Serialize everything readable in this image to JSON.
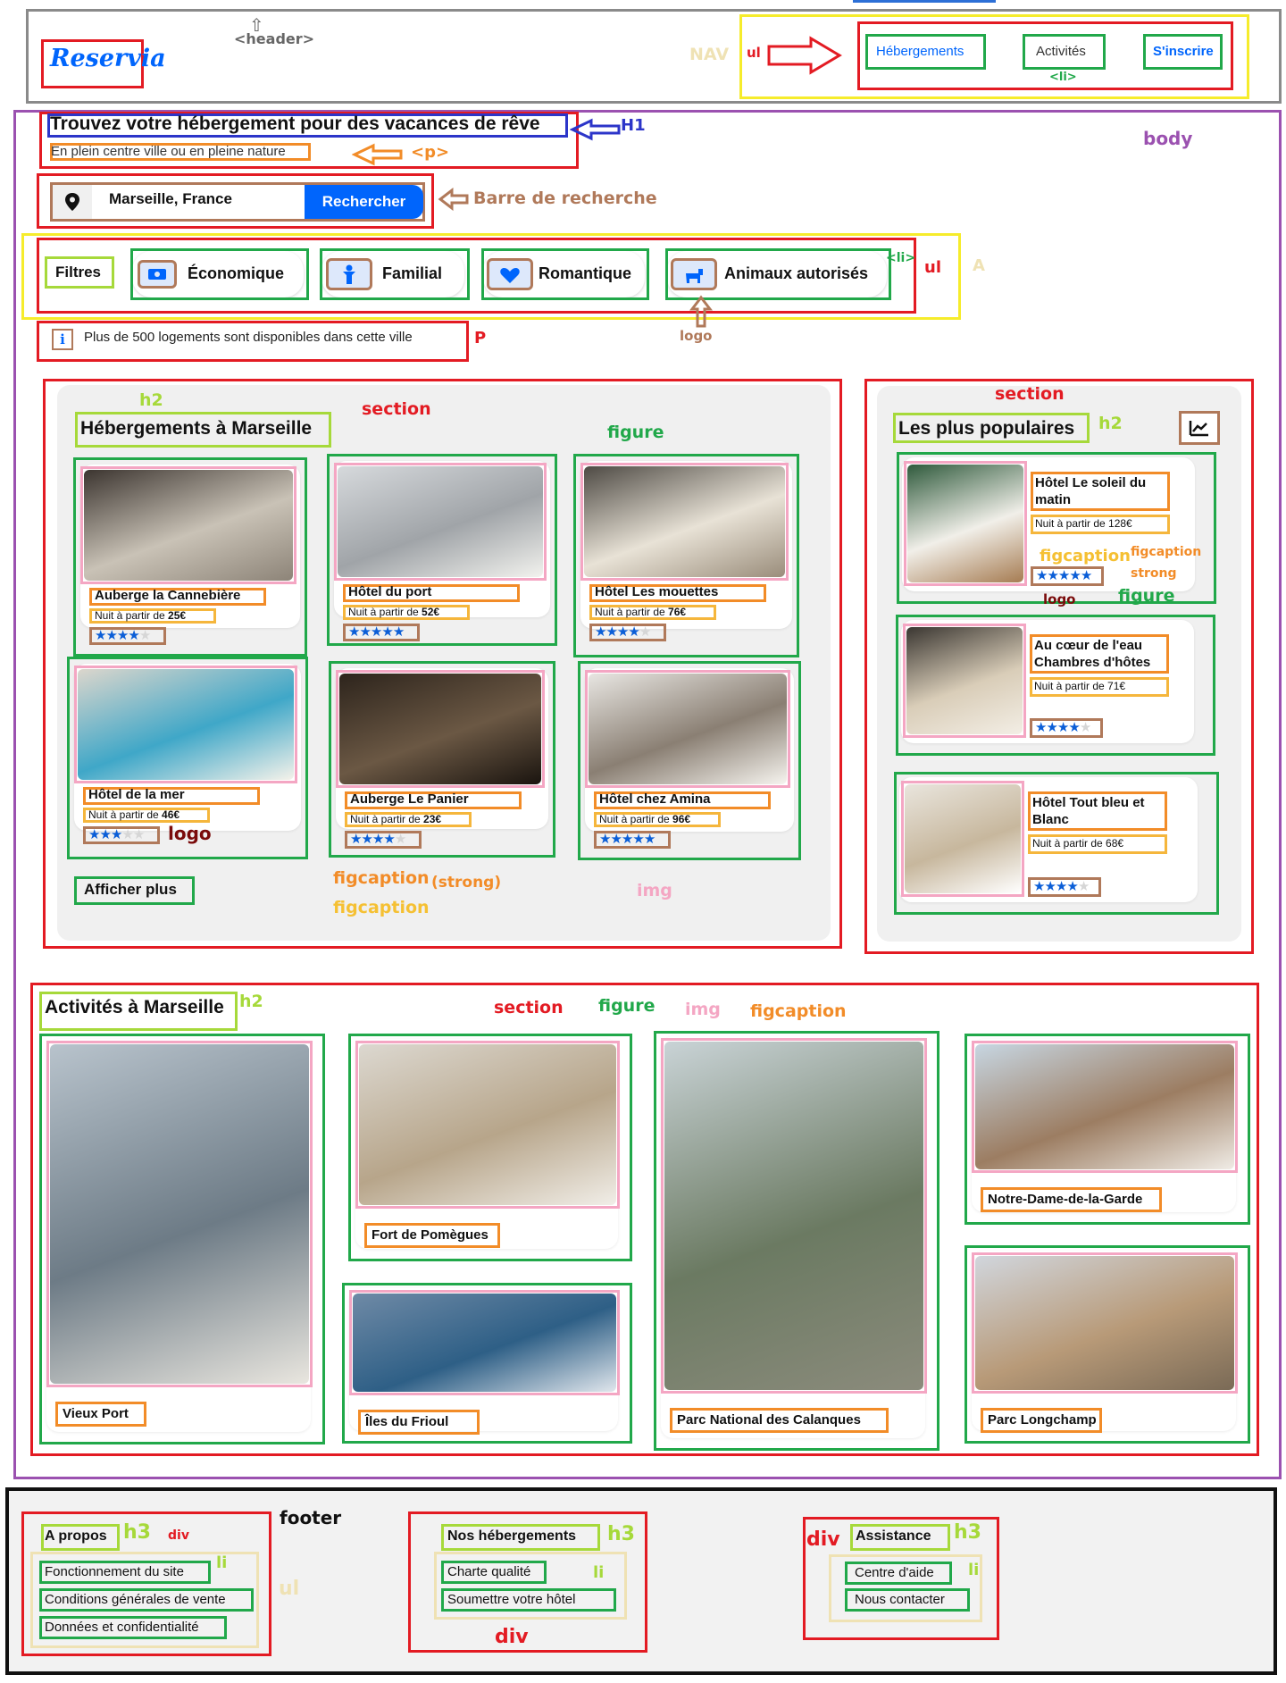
{
  "site": {
    "logo": "Reservia",
    "nav": [
      "Hébergements",
      "Activités",
      "S'inscrire"
    ],
    "h1": "Trouvez votre hébergement pour des vacances de rêve",
    "subtitle": "En plein centre ville ou en pleine nature",
    "search": {
      "value": "Marseille, France",
      "button": "Rechercher"
    },
    "filters_label": "Filtres",
    "filters": [
      "Économique",
      "Familial",
      "Romantique",
      "Animaux autorisés"
    ],
    "info": "Plus de 500 logements sont disponibles dans cette ville",
    "accommodations_title": "Hébergements à Marseille",
    "show_more": "Afficher plus",
    "popular_title": "Les plus populaires",
    "activities_title": "Activités à Marseille",
    "footer": {
      "col1": {
        "title": "A propos",
        "items": [
          "Fonctionnement du site",
          "Conditions générales de vente",
          "Données et confidentialité"
        ]
      },
      "col2": {
        "title": "Nos hébergements",
        "items": [
          "Charte qualité",
          "Soumettre votre hôtel"
        ]
      },
      "col3": {
        "title": "Assistance",
        "items": [
          "Centre d'aide",
          "Nous contacter"
        ]
      }
    }
  },
  "hotels": [
    {
      "name": "Auberge la Cannebière",
      "price_prefix": "Nuit à partir de ",
      "price": "25€",
      "rating": 4
    },
    {
      "name": "Hôtel du port",
      "price_prefix": "Nuit à partir de ",
      "price": "52€",
      "rating": 5
    },
    {
      "name": "Hôtel Les mouettes",
      "price_prefix": "Nuit à partir de ",
      "price": "76€",
      "rating": 4
    },
    {
      "name": "Hôtel de la mer",
      "price_prefix": "Nuit à partir de ",
      "price": "46€",
      "rating": 3
    },
    {
      "name": "Auberge Le Panier",
      "price_prefix": "Nuit à partir de ",
      "price": "23€",
      "rating": 4
    },
    {
      "name": "Hôtel chez Amina",
      "price_prefix": "Nuit à partir de ",
      "price": "96€",
      "rating": 5
    }
  ],
  "popular": [
    {
      "name_line1": "Hôtel Le soleil du",
      "name_line2": "matin",
      "price": "Nuit à partir de 128€",
      "rating": 5
    },
    {
      "name_line1": "Au cœur de l'eau",
      "name_line2": "Chambres d'hôtes",
      "price": "Nuit à partir de 71€",
      "rating": 4
    },
    {
      "name_line1": "Hôtel Tout bleu et",
      "name_line2": "Blanc",
      "price": "Nuit à partir de 68€",
      "rating": 4
    }
  ],
  "activities": [
    "Vieux Port",
    "Fort de Pomègues",
    "Îles du Frioul",
    "Parc National des Calanques",
    "Notre-Dame-de-la-Garde",
    "Parc Longchamp"
  ],
  "annotations": {
    "header": "<header>",
    "nav": "NAV",
    "ul": "ul",
    "li": "<li>",
    "h1": "H1",
    "p_tag": "<p>",
    "searchbar": "Barre de recherche",
    "li_filters": "<li>",
    "ul_filters": "ul",
    "a": "A",
    "logo": "logo",
    "p": "P",
    "body": "body",
    "h2": "h2",
    "section": "section",
    "figure": "figure",
    "figcaption": "figcaption",
    "strong": "strong",
    "strong_paren": "(strong)",
    "img": "img",
    "div": "div",
    "h3": "h3",
    "footer": "footer",
    "li_footer": "li"
  },
  "colors": {
    "brand": "#0065fc",
    "red": "#e31b23",
    "green": "#21a84a",
    "orange": "#f28c28",
    "yellow": "#f6ec2b",
    "pink": "#f4a6c3",
    "lime": "#a6d93a",
    "blue": "#2c35c9",
    "purple": "#9b51b0",
    "brown": "#b0795a"
  }
}
